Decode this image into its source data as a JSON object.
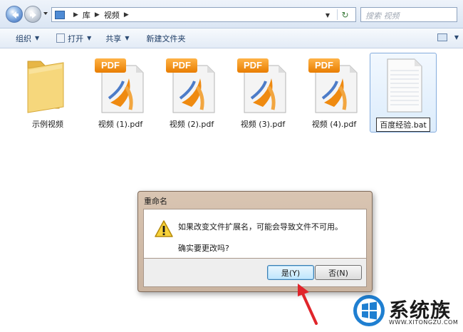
{
  "address": {
    "path": [
      "库",
      "视频"
    ],
    "search_placeholder": "搜索 视频"
  },
  "toolbar": {
    "organize": "组织",
    "open": "打开",
    "share": "共享",
    "new_folder": "新建文件夹"
  },
  "files": [
    {
      "name": "示例视频",
      "type": "folder"
    },
    {
      "name": "视频 (1).pdf",
      "type": "pdf",
      "badge": "PDF"
    },
    {
      "name": "视频 (2).pdf",
      "type": "pdf",
      "badge": "PDF"
    },
    {
      "name": "视频 (3).pdf",
      "type": "pdf",
      "badge": "PDF"
    },
    {
      "name": "视频 (4).pdf",
      "type": "pdf",
      "badge": "PDF"
    },
    {
      "name": "百度经验.bat",
      "type": "bat",
      "renaming": true
    }
  ],
  "dialog": {
    "title": "重命名",
    "message": "如果改变文件扩展名，可能会导致文件不可用。",
    "question": "确实要更改吗?",
    "yes_label": "是(Y)",
    "no_label": "否(N)"
  },
  "watermark": {
    "brand": "系统族",
    "url": "WWW.XITONGZU.COM"
  },
  "colors": {
    "pdf_orange": "#e87d00",
    "dialog_frame": "#c9b3a0",
    "arrow_red": "#e0252b",
    "folder_yellow": "#f2c65a"
  }
}
